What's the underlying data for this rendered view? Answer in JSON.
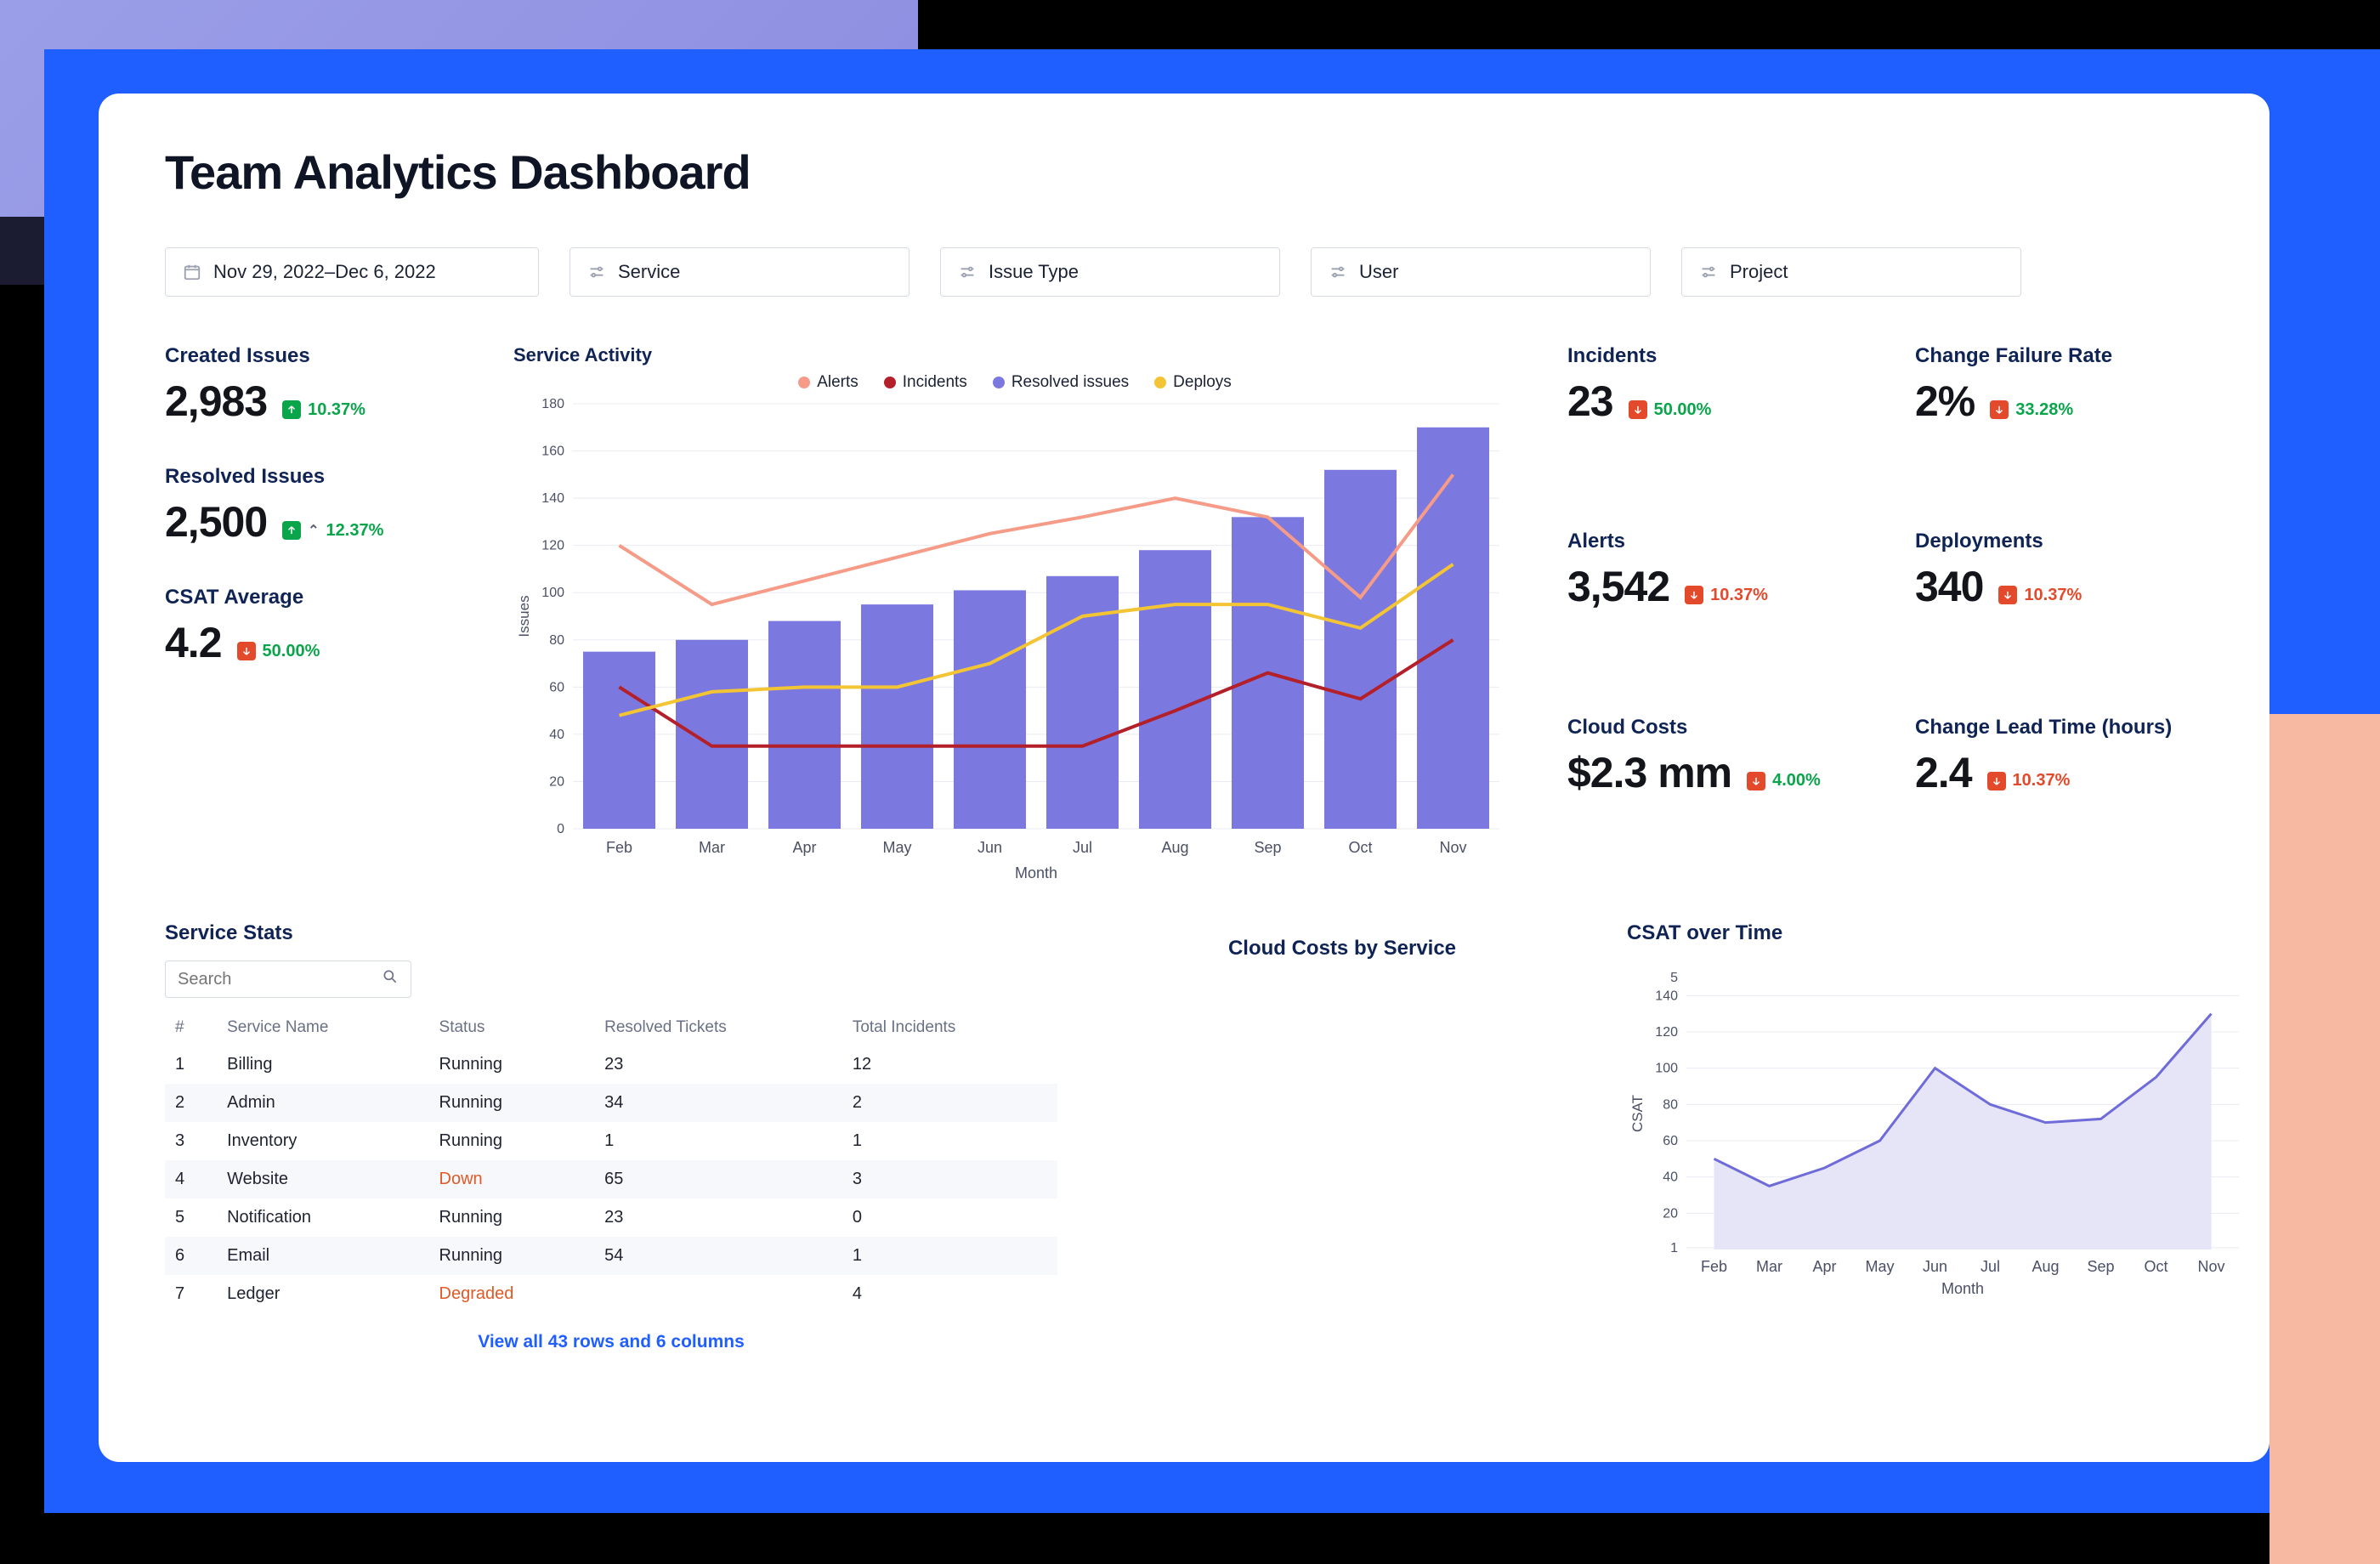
{
  "title": "Team Analytics Dashboard",
  "filters": {
    "date_range": "Nov 29, 2022–Dec 6, 2022",
    "selects": [
      "Service",
      "Issue Type",
      "User",
      "Project"
    ]
  },
  "metrics_left": [
    {
      "label": "Created Issues",
      "value": "2,983",
      "delta": "10.37%",
      "dir": "up",
      "color": "green"
    },
    {
      "label": "Resolved Issues",
      "value": "2,500",
      "delta": "12.37%",
      "dir": "up",
      "color": "green",
      "caret": true
    },
    {
      "label": "CSAT Average",
      "value": "4.2",
      "delta": "50.00%",
      "dir": "down",
      "color": "green"
    }
  ],
  "metrics_right": [
    {
      "label": "Incidents",
      "value": "23",
      "delta": "50.00%",
      "dir": "down",
      "color": "green"
    },
    {
      "label": "Change Failure Rate",
      "value": "2%",
      "delta": "33.28%",
      "dir": "down",
      "color": "green"
    },
    {
      "label": "Alerts",
      "value": "3,542",
      "delta": "10.37%",
      "dir": "down",
      "color": "red"
    },
    {
      "label": "Deployments",
      "value": "340",
      "delta": "10.37%",
      "dir": "down",
      "color": "red"
    },
    {
      "label": "Cloud Costs",
      "value": "$2.3 mm",
      "delta": "4.00%",
      "dir": "down",
      "color": "green"
    },
    {
      "label": "Change Lead Time (hours)",
      "value": "2.4",
      "delta": "10.37%",
      "dir": "down",
      "color": "red"
    }
  ],
  "chart_data": [
    {
      "id": "service_activity",
      "type": "bar+line",
      "title": "Service Activity",
      "xlabel": "Month",
      "ylabel": "Issues",
      "ylim": [
        0,
        180
      ],
      "yticks": [
        0,
        20,
        40,
        60,
        80,
        100,
        120,
        140,
        160,
        180
      ],
      "categories": [
        "Feb",
        "Mar",
        "Apr",
        "May",
        "Jun",
        "Jul",
        "Aug",
        "Sep",
        "Oct",
        "Nov"
      ],
      "legend": [
        {
          "name": "Alerts",
          "color": "#f59b87",
          "kind": "line"
        },
        {
          "name": "Incidents",
          "color": "#b4202a",
          "kind": "line"
        },
        {
          "name": "Resolved issues",
          "color": "#7b79e0",
          "kind": "bar"
        },
        {
          "name": "Deploys",
          "color": "#f3c433",
          "kind": "line"
        }
      ],
      "series": [
        {
          "name": "Resolved issues",
          "kind": "bar",
          "values": [
            75,
            80,
            88,
            95,
            101,
            107,
            118,
            132,
            152,
            170
          ]
        },
        {
          "name": "Alerts",
          "kind": "line",
          "values": [
            120,
            95,
            105,
            115,
            125,
            132,
            140,
            132,
            98,
            150
          ]
        },
        {
          "name": "Incidents",
          "kind": "line",
          "values": [
            60,
            35,
            35,
            35,
            35,
            35,
            50,
            66,
            55,
            80
          ]
        },
        {
          "name": "Deploys",
          "kind": "line",
          "values": [
            48,
            58,
            60,
            60,
            70,
            90,
            95,
            95,
            85,
            112
          ]
        }
      ]
    },
    {
      "id": "csat_over_time",
      "type": "area",
      "title": "CSAT over Time",
      "xlabel": "Month",
      "ylabel": "CSAT",
      "categories": [
        "Feb",
        "Mar",
        "Apr",
        "May",
        "Jun",
        "Jul",
        "Aug",
        "Sep",
        "Oct",
        "Nov"
      ],
      "yticks": [
        1,
        20,
        40,
        60,
        80,
        100,
        120,
        140,
        "5"
      ],
      "values": [
        50,
        35,
        45,
        60,
        100,
        80,
        70,
        72,
        95,
        130
      ]
    }
  ],
  "sections": {
    "cloud_costs_title": "Cloud Costs by Service",
    "service_stats_title": "Service Stats",
    "csat_title": "CSAT over Time"
  },
  "service_stats": {
    "search_placeholder": "Search",
    "columns": [
      "#",
      "Service Name",
      "Status",
      "Resolved Tickets",
      "Total Incidents"
    ],
    "rows": [
      {
        "n": "1",
        "name": "Billing",
        "status": "Running",
        "resolved": "23",
        "incidents": "12"
      },
      {
        "n": "2",
        "name": "Admin",
        "status": "Running",
        "resolved": "34",
        "incidents": "2"
      },
      {
        "n": "3",
        "name": "Inventory",
        "status": "Running",
        "resolved": "1",
        "incidents": "1"
      },
      {
        "n": "4",
        "name": "Website",
        "status": "Down",
        "resolved": "65",
        "incidents": "3"
      },
      {
        "n": "5",
        "name": "Notification",
        "status": "Running",
        "resolved": "23",
        "incidents": "0"
      },
      {
        "n": "6",
        "name": "Email",
        "status": "Running",
        "resolved": "54",
        "incidents": "1"
      },
      {
        "n": "7",
        "name": "Ledger",
        "status": "Degraded",
        "resolved": "",
        "incidents": "4"
      }
    ],
    "view_all": "View all 43 rows and 6 columns"
  },
  "colors": {
    "purple": "#7b79e0",
    "alerts": "#f59b87",
    "incidents": "#b4202a",
    "deploys": "#f3c433",
    "blue": "#1f5eff"
  }
}
